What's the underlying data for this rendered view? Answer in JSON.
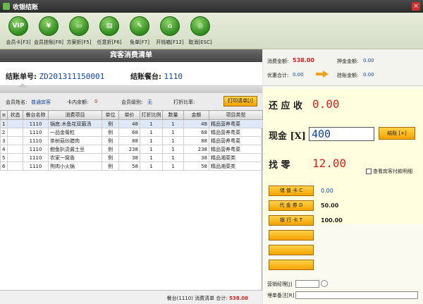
{
  "window": {
    "title": "收银结账",
    "close": "×"
  },
  "toolbar": {
    "buttons": [
      {
        "icon_text": "VIP",
        "label": "会员卡[F3]"
      },
      {
        "icon_text": "¥",
        "label": "会员挂账[F8]"
      },
      {
        "icon_text": "▭",
        "label": "方案折[F5]"
      },
      {
        "icon_text": "▤",
        "label": "任意折[F6]"
      },
      {
        "icon_text": "✎",
        "label": "免单[F7]"
      },
      {
        "icon_text": "⌂",
        "label": "开钱箱[F12]"
      },
      {
        "icon_text": "◎",
        "label": "取消[ESC]"
      }
    ]
  },
  "list": {
    "title": "宾客消费清单",
    "bill_no_label": "结账单号:",
    "bill_no": "ZD201311150001",
    "table_label": "结账餐台:",
    "table_no": "1110",
    "member_name_label": "会员姓名:",
    "member_name": "普通宾客",
    "card_balance_label": "卡内余额:",
    "card_balance": "0",
    "member_level_label": "会员级别:",
    "member_level": "无",
    "discount_label": "打折比率:",
    "print_btn": "打印清单[/]",
    "columns": [
      "状态",
      "餐台名称",
      "消费项目",
      "单位",
      "单价",
      "打折比例",
      "数量",
      "金额",
      "项目类型"
    ],
    "rows": [
      {
        "idx": "1",
        "table": "1110",
        "item": "锅底:木鱼花双菌汤",
        "unit": "例",
        "price": "48",
        "disc": "1",
        "qty": "1",
        "amount": "48",
        "type": "精品营养粤菜"
      },
      {
        "idx": "2",
        "table": "1110",
        "item": "一品金菊粒",
        "unit": "例",
        "price": "68",
        "disc": "1",
        "qty": "1",
        "amount": "68",
        "type": "精品营养粤菜"
      },
      {
        "idx": "3",
        "table": "1110",
        "item": "茶树菇炒腊肉",
        "unit": "例",
        "price": "88",
        "disc": "1",
        "qty": "1",
        "amount": "88",
        "type": "精品营养粤菜"
      },
      {
        "idx": "4",
        "table": "1110",
        "item": "鲍鱼扒烫酱土豆",
        "unit": "例",
        "price": "238",
        "disc": "1",
        "qty": "1",
        "amount": "238",
        "type": "精品营养粤菜"
      },
      {
        "idx": "5",
        "table": "1110",
        "item": "农家一窝香",
        "unit": "例",
        "price": "38",
        "disc": "1",
        "qty": "1",
        "amount": "38",
        "type": "精品湘菜类"
      },
      {
        "idx": "6",
        "table": "1110",
        "item": "狗肉小火锅",
        "unit": "例",
        "price": "58",
        "disc": "1",
        "qty": "1",
        "amount": "58",
        "type": "精品湘菜类"
      }
    ],
    "footer_prefix": "餐台(1110) 消费清单 合计:",
    "footer_total": "538.00"
  },
  "summary": {
    "consume_label": "消费金额:",
    "consume": "538.00",
    "deposit_label": "押金金额:",
    "deposit": "0.00",
    "discount_label": "优惠合计:",
    "discount": "0.00",
    "credit_label": "挂账金额:",
    "credit": "0.00"
  },
  "payment": {
    "receivable_label": "还 应 收",
    "receivable": "0.00",
    "cash_label": "现金 [X]",
    "cash_value": "400",
    "settle_btn": "结账 [+]",
    "change_label": "找   零",
    "change": "12.00",
    "show_detail": "查看宾客付款明细",
    "methods": [
      {
        "label": "储 值 卡 C",
        "value": "0.00"
      },
      {
        "label": "代 金 券 D",
        "value": "50.00"
      },
      {
        "label": "银 行 卡 T",
        "value": "100.00"
      },
      {
        "label": "",
        "value": ""
      },
      {
        "label": "",
        "value": ""
      },
      {
        "label": "",
        "value": ""
      }
    ],
    "manager_label": "营销经理[J]",
    "note_label": "埋单备注[R]"
  }
}
